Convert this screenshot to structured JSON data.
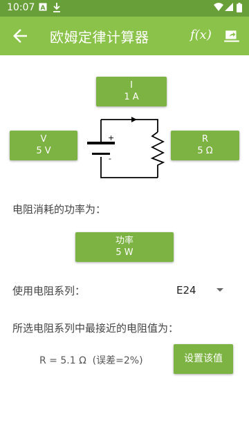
{
  "status_bar": {
    "time": "10:07",
    "left_icons": [
      "a-notification-icon",
      "download-icon"
    ],
    "right_icons": [
      "wifi-icon",
      "cell-signal-icon",
      "battery-icon"
    ]
  },
  "app_bar": {
    "title": "欧姆定律计算器",
    "function_label": "f(x)",
    "icons": [
      "back-arrow-icon",
      "share-icon"
    ]
  },
  "circuit": {
    "current": {
      "name": "I",
      "value": "1 A"
    },
    "voltage": {
      "name": "V",
      "value": "5 V"
    },
    "resistance": {
      "name": "R",
      "value": "5 Ω"
    },
    "battery_plus": "+",
    "battery_minus": "-"
  },
  "power": {
    "prompt": "电阻消耗的功率为：",
    "name": "功率",
    "value": "5 W"
  },
  "series": {
    "prompt": "使用电阻系列：",
    "selected": "E24"
  },
  "nearest": {
    "prompt": "所选电阻系列中最接近的电阻值为：",
    "result": "R = 5.1 Ω  (误差=2%)",
    "set_button": "设置该值"
  },
  "colors": {
    "status_bar": "#689f38",
    "app_bar": "#8bc34a",
    "button": "#7cb342"
  }
}
